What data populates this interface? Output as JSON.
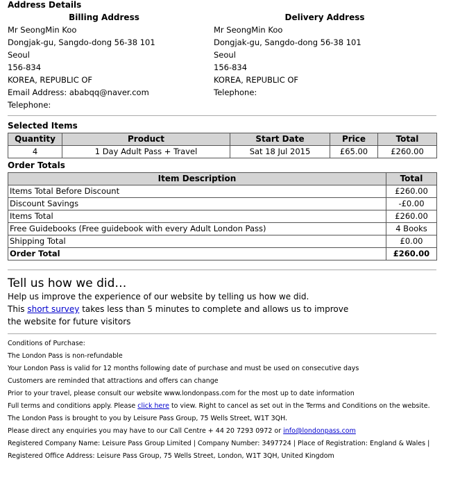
{
  "address_details": {
    "title": "Address Details",
    "billing": {
      "header": "Billing Address",
      "name": "Mr SeongMin Koo",
      "street": "Dongjak-gu, Sangdo-dong 56-38 101",
      "city": "Seoul",
      "postcode": "156-834",
      "country": "KOREA, REPUBLIC OF",
      "email": "Email Address: ababqq@naver.com",
      "telephone": "Telephone:"
    },
    "delivery": {
      "header": "Delivery Address",
      "name": "Mr SeongMin Koo",
      "street": "Dongjak-gu, Sangdo-dong 56-38 101",
      "city": "Seoul",
      "postcode": "156-834",
      "country": "KOREA, REPUBLIC OF",
      "telephone": "Telephone:"
    }
  },
  "selected_items": {
    "title": "Selected Items",
    "headers": [
      "Quantity",
      "Product",
      "Start Date",
      "Price",
      "Total"
    ],
    "rows": [
      {
        "quantity": "4",
        "product": "1 Day Adult Pass + Travel",
        "start_date": "Sat 18 Jul 2015",
        "price": "£65.00",
        "total": "£260.00"
      }
    ]
  },
  "order_totals": {
    "title": "Order Totals",
    "headers": [
      "Item Description",
      "Total"
    ],
    "rows": [
      {
        "desc": "Items Total Before Discount",
        "val": "£260.00"
      },
      {
        "desc": "Discount Savings",
        "val": "-£0.00"
      },
      {
        "desc": "Items Total",
        "val": "£260.00"
      },
      {
        "desc": "Free Guidebooks (Free guidebook with every Adult London Pass)",
        "val": "4 Books"
      },
      {
        "desc": "Shipping Total",
        "val": "£0.00"
      },
      {
        "desc": "Order Total",
        "val": "£260.00"
      }
    ]
  },
  "feedback": {
    "title": "Tell us how we did…",
    "line1": "Help us improve the experience of our website by telling us how we did.",
    "line2_pre": "This ",
    "survey_link": "short survey",
    "line2_post": " takes less than 5 minutes to complete and allows us to improve",
    "line3": "the website for future visitors"
  },
  "conditions": {
    "heading": "Conditions of Purchase:",
    "l1": "The London Pass is non-refundable",
    "l2": "Your London Pass is valid for 12 months following date of purchase and must be used on consecutive days",
    "l3": "Customers are reminded that attractions and offers can change",
    "l4": "Prior to your travel, please consult our website www.londonpass.com for the most up to date information",
    "l5_pre": "Full terms and conditions apply. Please ",
    "l5_link": "click here",
    "l5_post": " to view. Right to cancel as set out in the Terms and Conditions on the website.",
    "l6": "The London Pass is brought to you by Leisure Pass Group, 75 Wells Street, W1T 3QH.",
    "l7_pre": "Please direct any enquiries you may have to our Call Centre + 44 20 7293 0972 or ",
    "l7_link": "info@londonpass.com",
    "l8": "Registered Company Name: Leisure Pass Group Limited | Company Number: 3497724 | Place of Registration: England & Wales |",
    "l9": "Registered Office Address: Leisure Pass Group, 75 Wells Street, London, W1T 3QH, United Kingdom"
  }
}
